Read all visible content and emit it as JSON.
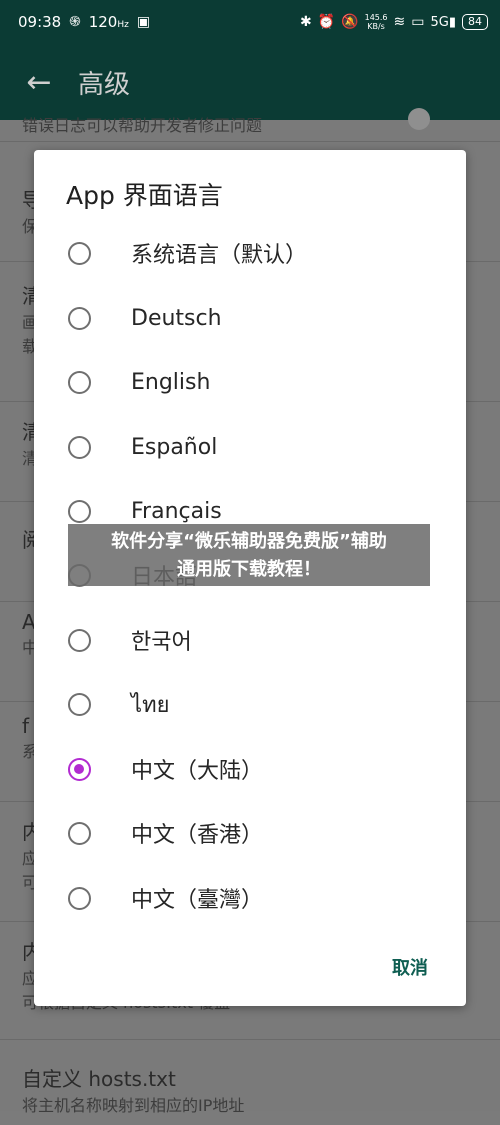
{
  "status_bar": {
    "time": "09:38",
    "hd_badge": "120",
    "net_speed_value": "145.6",
    "net_speed_unit": "KB/s",
    "signal": "5G",
    "battery": "84"
  },
  "app_bar": {
    "title": "高级"
  },
  "background_items": [
    {
      "title": "",
      "subtitle": "错误日志可以帮助开发者修正问题"
    },
    {
      "title": "导",
      "subtitle": "保"
    },
    {
      "title": "清",
      "subtitle": "画"
    },
    {
      "title": "",
      "subtitle": "载"
    },
    {
      "title": "清",
      "subtitle": "清"
    },
    {
      "title": "阅",
      "subtitle": ""
    },
    {
      "title": "A",
      "subtitle": "中"
    },
    {
      "title": "f",
      "subtitle": "系"
    },
    {
      "title": "内",
      "subtitle": "应"
    },
    {
      "title": "",
      "subtitle": "可"
    },
    {
      "title": "内",
      "subtitle": "应"
    },
    {
      "title": "",
      "subtitle": "可根据自定义 hosts.txt 覆盖"
    },
    {
      "title": "自定义 hosts.txt",
      "subtitle": "将主机名称映射到相应的IP地址"
    }
  ],
  "dialog": {
    "title": "App 界面语言",
    "options": [
      {
        "label": "系统语言（默认）",
        "checked": false
      },
      {
        "label": "Deutsch",
        "checked": false
      },
      {
        "label": "English",
        "checked": false
      },
      {
        "label": "Español",
        "checked": false
      },
      {
        "label": "Français",
        "checked": false
      },
      {
        "label": "日本語",
        "checked": false
      },
      {
        "label": "한국어",
        "checked": false
      },
      {
        "label": "ไทย",
        "checked": false
      },
      {
        "label": "中文（大陆）",
        "checked": true
      },
      {
        "label": "中文（香港）",
        "checked": false
      },
      {
        "label": "中文（臺灣）",
        "checked": false
      }
    ],
    "cancel_label": "取消"
  },
  "watermark": {
    "line1": "软件分享“微乐辅助器免费版”辅助",
    "line2": "通用版下载教程！"
  },
  "colors": {
    "app_bar": "#0b3b34",
    "accent_radio": "#b22bd1",
    "cancel_text": "#0f5e52"
  }
}
